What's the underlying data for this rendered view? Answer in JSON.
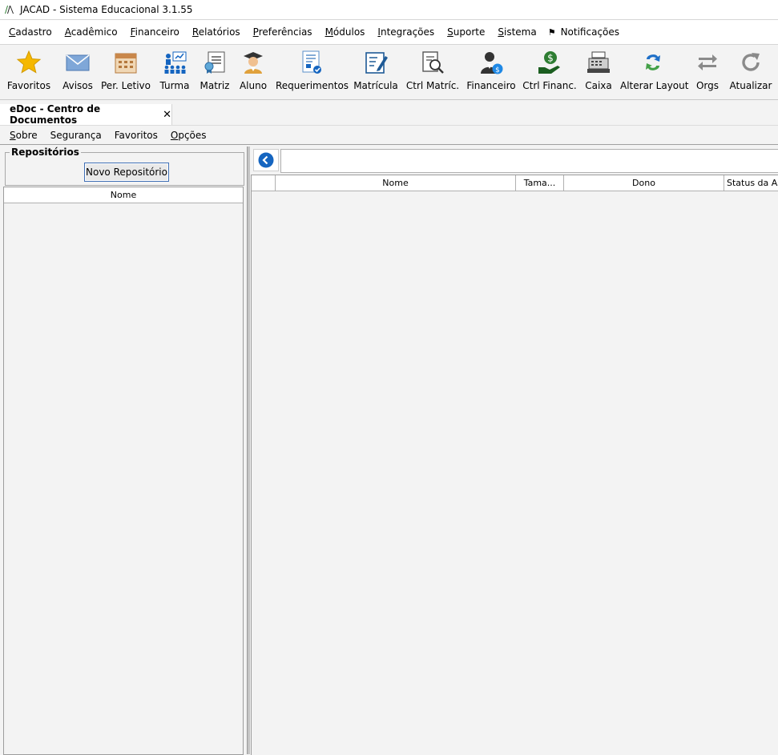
{
  "window": {
    "title": "JACAD - Sistema Educacional 3.1.55"
  },
  "menubar": {
    "items": [
      {
        "pre": "",
        "ul": "C",
        "post": "adastro"
      },
      {
        "pre": "",
        "ul": "A",
        "post": "cadêmico"
      },
      {
        "pre": "",
        "ul": "F",
        "post": "inanceiro"
      },
      {
        "pre": "",
        "ul": "R",
        "post": "elatórios"
      },
      {
        "pre": "",
        "ul": "P",
        "post": "referências"
      },
      {
        "pre": "",
        "ul": "M",
        "post": "ódulos"
      },
      {
        "pre": "",
        "ul": "I",
        "post": "ntegrações"
      },
      {
        "pre": "",
        "ul": "S",
        "post": "uporte"
      },
      {
        "pre": "",
        "ul": "S",
        "post": "istema"
      }
    ],
    "notifications": "Notificações"
  },
  "toolbar": {
    "items": [
      {
        "label": "Favoritos",
        "icon": "star-icon"
      },
      {
        "label": "Avisos",
        "icon": "envelope-icon"
      },
      {
        "label": "Per. Letivo",
        "icon": "calendar-icon"
      },
      {
        "label": "Turma",
        "icon": "class-group-icon"
      },
      {
        "label": "Matriz",
        "icon": "certificate-icon"
      },
      {
        "label": "Aluno",
        "icon": "graduate-icon"
      },
      {
        "label": "Requerimentos",
        "icon": "request-document-icon"
      },
      {
        "label": "Matrícula",
        "icon": "enrollment-edit-icon"
      },
      {
        "label": "Ctrl Matríc.",
        "icon": "enrollment-search-icon"
      },
      {
        "label": "Financeiro",
        "icon": "financial-user-icon"
      },
      {
        "label": "Ctrl Financ.",
        "icon": "money-hand-icon"
      },
      {
        "label": "Caixa",
        "icon": "cash-register-icon"
      },
      {
        "label": "Alterar Layout",
        "icon": "swap-layout-icon"
      },
      {
        "label": "Orgs",
        "icon": "arrows-exchange-icon"
      },
      {
        "label": "Atualizar",
        "icon": "refresh-icon"
      }
    ]
  },
  "tabs": [
    {
      "label": "eDoc - Centro de Documentos",
      "close": "✕"
    }
  ],
  "submenu": {
    "items": [
      {
        "pre": "",
        "ul": "S",
        "post": "obre"
      },
      {
        "pre": "Segurança",
        "ul": "",
        "post": ""
      },
      {
        "pre": "Favoritos",
        "ul": "",
        "post": ""
      },
      {
        "pre": "",
        "ul": "O",
        "post": "pções"
      }
    ]
  },
  "left": {
    "group_title": "Repositórios",
    "new_button": "Novo Repositório",
    "table_header": "Nome"
  },
  "right": {
    "path_value": "",
    "columns": [
      "",
      "Nome",
      "Tama...",
      "Dono",
      "Status da Ass"
    ]
  },
  "colors": {
    "accent_blue": "#1565c0",
    "star": "#f5b800",
    "green": "#2e7d32"
  }
}
